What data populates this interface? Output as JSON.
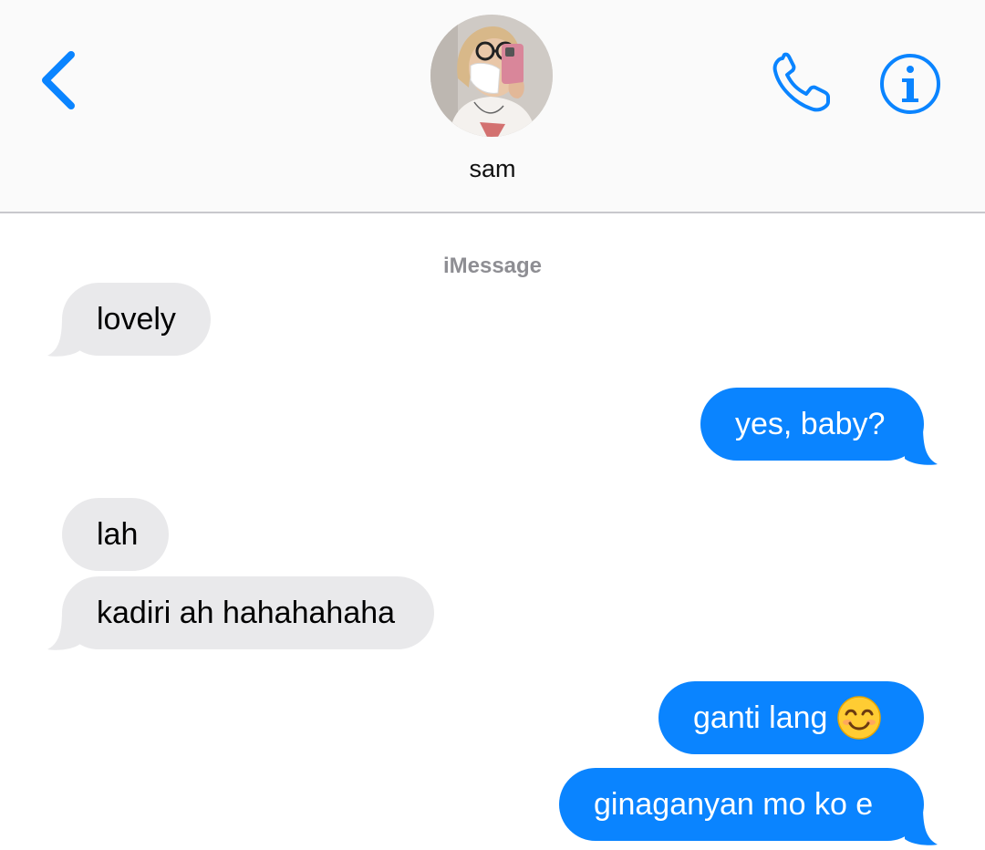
{
  "header": {
    "contact_name": "sam",
    "back_icon": "chevron-left-icon",
    "call_icon": "phone-icon",
    "info_icon": "info-icon",
    "accent_color": "#0a84ff"
  },
  "conversation": {
    "service_label": "iMessage",
    "messages": [
      {
        "direction": "incoming",
        "text": "lovely"
      },
      {
        "direction": "outgoing",
        "text": "yes, baby?"
      },
      {
        "direction": "incoming",
        "text": "lah"
      },
      {
        "direction": "incoming",
        "text": "kadiri ah hahahahaha"
      },
      {
        "direction": "outgoing",
        "text": "ganti lang",
        "emoji": "smiling-face-emoji"
      },
      {
        "direction": "outgoing",
        "text": "ginaganyan mo ko e"
      }
    ],
    "incoming_color": "#e9e9eb",
    "outgoing_color": "#0a84ff"
  }
}
